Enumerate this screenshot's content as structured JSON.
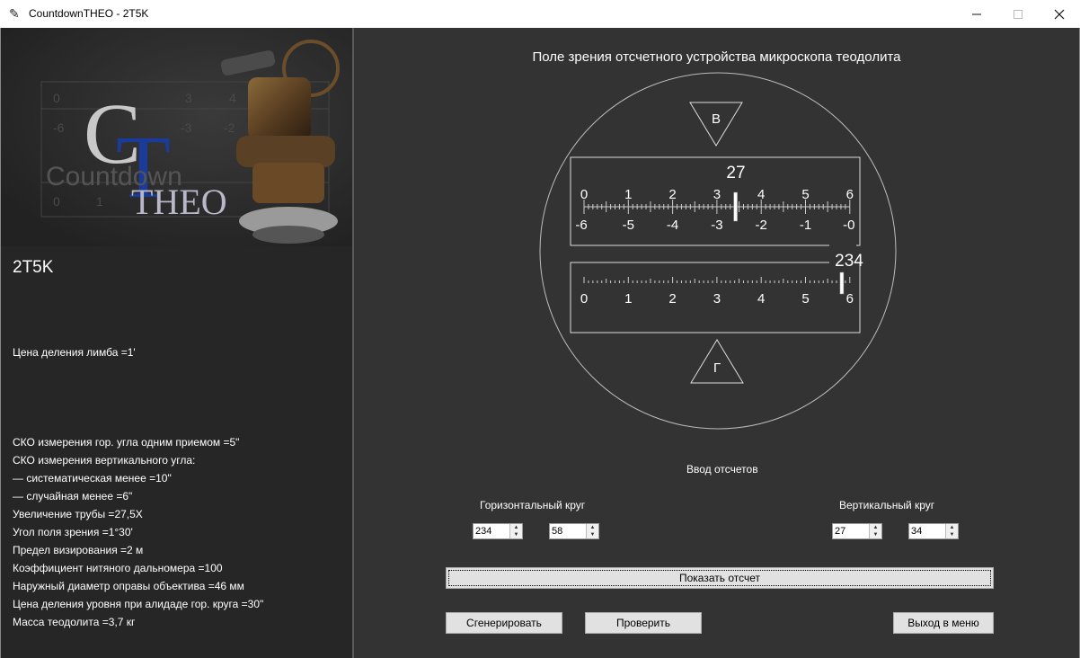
{
  "window": {
    "title": "CountdownTHEO - 2T5K",
    "app_icon": "feather-icon",
    "controls": [
      "minimize-icon",
      "maximize-icon",
      "close-icon"
    ]
  },
  "logo": {
    "line1": "Countdown",
    "line2": "THEO",
    "monogram_c": "C",
    "monogram_t": "T"
  },
  "instrument": {
    "model": "2T5K",
    "division": "Цена деления лимба =1'",
    "specs": [
      "СКО измерения гор. угла одним приемом =5\"",
      "СКО измерения вертикального угла:",
      "— систематическая менее =10\"",
      "— случайная менее =6\"",
      "Увеличение трубы =27,5X",
      "Угол поля зрения =1°30'",
      "Предел визирования =2 м",
      "Коэффициент нитяного дальномера =100",
      "Наружный диаметр оправы объектива =46 мм",
      "Цена деления уровня при алидаде гор. круга =30\"",
      "Масса теодолита =3,7 кг"
    ]
  },
  "viewer": {
    "title": "Поле зрения отсчетного устройства микроскопа теодолита",
    "top_marker": "В",
    "bottom_marker": "Г",
    "vertical": {
      "degree": "27",
      "top_labels": [
        "0",
        "1",
        "2",
        "3",
        "4",
        "5",
        "6"
      ],
      "bottom_labels": [
        "-6",
        "-5",
        "-4",
        "-3",
        "-2",
        "-1",
        "-0"
      ],
      "index_fraction": 0.57
    },
    "horizontal": {
      "degree": "234",
      "labels": [
        "0",
        "1",
        "2",
        "3",
        "4",
        "5",
        "6"
      ],
      "index_fraction": 0.97
    }
  },
  "input": {
    "section_label": "Ввод отсчетов",
    "horizontal_label": "Горизонтальный круг",
    "vertical_label": "Вертикальный круг",
    "h_deg": "234",
    "h_min": "58",
    "v_deg": "27",
    "v_min": "34"
  },
  "buttons": {
    "show": "Показать отсчет",
    "generate": "Сгенерировать",
    "check": "Проверить",
    "exit": "Выход в меню"
  }
}
